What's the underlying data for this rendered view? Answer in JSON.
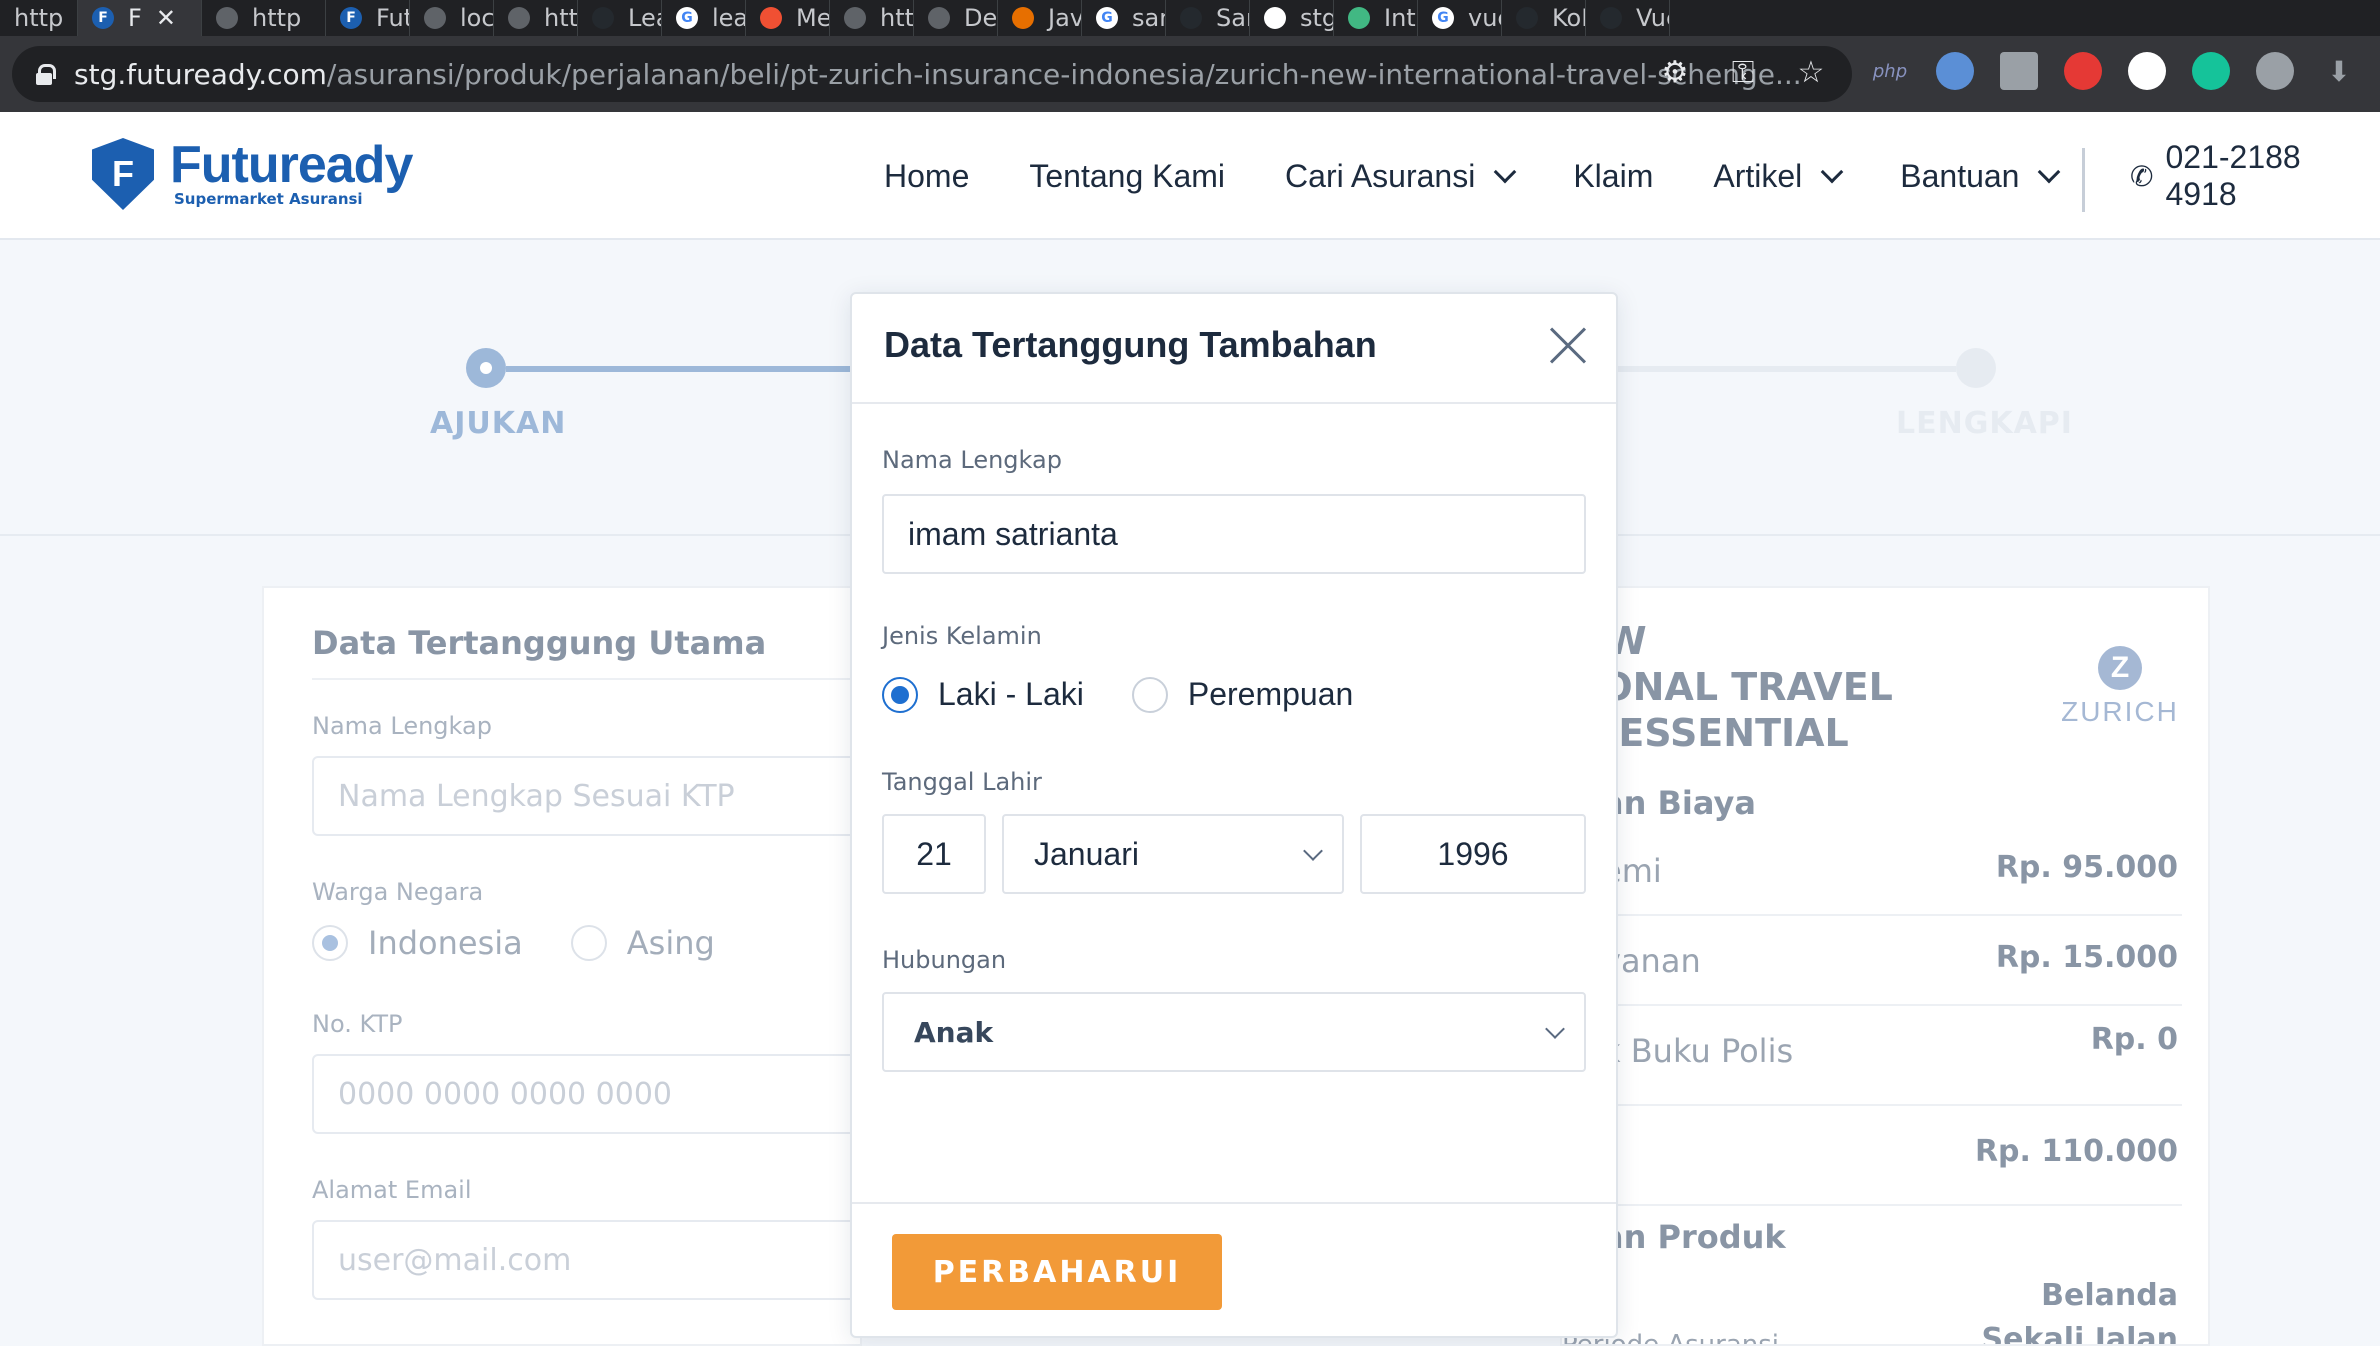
{
  "browser": {
    "tabs": [
      {
        "label": "http",
        "color": "#5f6368"
      },
      {
        "label": "F",
        "color": "#1c5fb0",
        "active": true
      },
      {
        "label": "http",
        "color": "#5f6368"
      },
      {
        "label": "Futu",
        "color": "#1c5fb0"
      },
      {
        "label": "loca",
        "color": "#5f6368"
      },
      {
        "label": "http",
        "color": "#5f6368"
      },
      {
        "label": "Lear",
        "color": "#24292e"
      },
      {
        "label": "learn",
        "color": "#4285f4"
      },
      {
        "label": "Men",
        "color": "#f05033"
      },
      {
        "label": "http",
        "color": "#5f6368"
      },
      {
        "label": "Dem",
        "color": "#5f6368"
      },
      {
        "label": "Java",
        "color": "#e76f00"
      },
      {
        "label": "sam",
        "color": "#4285f4"
      },
      {
        "label": "Sam",
        "color": "#24292e"
      },
      {
        "label": "stg.",
        "color": "#5f6368"
      },
      {
        "label": "Intro",
        "color": "#41b883"
      },
      {
        "label": "vue",
        "color": "#4285f4"
      },
      {
        "label": "KoR",
        "color": "#24292e"
      },
      {
        "label": "Vue",
        "color": "#24292e"
      }
    ],
    "url_host": "stg.futuready.com",
    "url_path": "/asuransi/produk/perjalanan/beli/pt-zurich-insurance-indonesia/zurich-new-international-travel-schenge...",
    "ext_label_php": "php"
  },
  "header": {
    "logo_letter": "F",
    "logo_name": "Futuready",
    "logo_tagline": "Supermarket Asuransi",
    "nav": {
      "home": "Home",
      "about": "Tentang Kami",
      "find": "Cari Asuransi",
      "claim": "Klaim",
      "article": "Artikel",
      "help": "Bantuan"
    },
    "phone": "021-2188 4918",
    "brand_color": "#1c5fb0"
  },
  "stepper": {
    "step1": "AJUKAN",
    "step3": "LENGKAPI"
  },
  "main_form": {
    "title": "Data Tertanggung Utama",
    "name_label": "Nama Lengkap",
    "name_placeholder": "Nama Lengkap Sesuai KTP",
    "nationality_label": "Warga Negara",
    "nationality_options": [
      "Indonesia",
      "Asing"
    ],
    "ktp_label": "No. KTP",
    "ktp_placeholder": "0000 0000 0000 0000",
    "email_label": "Alamat Email",
    "email_placeholder": "user@mail.com"
  },
  "summary": {
    "product_lines": [
      "H NEW",
      "NATIONAL TRAVEL",
      "IGEN ESSENTIAL"
    ],
    "insurer": "ZURICH",
    "cost_section": "an Biaya",
    "premium_label": "emi",
    "premium_value": "Rp. 95.000",
    "service_label": "yanan",
    "service_value": "Rp. 15.000",
    "book_label": "k Buku Polis",
    "book_value": "Rp. 0",
    "total_value": "Rp. 110.000",
    "product_section": "an Produk",
    "destination_value": "Belanda",
    "period_label": "Periode Asuransi",
    "period_value": "Sekali Jalan"
  },
  "modal": {
    "title": "Data Tertanggung Tambahan",
    "name_label": "Nama Lengkap",
    "name_value": "imam satrianta",
    "gender_label": "Jenis Kelamin",
    "gender_male": "Laki - Laki",
    "gender_female": "Perempuan",
    "gender_selected": "Laki - Laki",
    "dob_label": "Tanggal Lahir",
    "dob_day": "21",
    "dob_month": "Januari",
    "dob_year": "1996",
    "relation_label": "Hubungan",
    "relation_value": "Anak",
    "submit": "PERBAHARUI",
    "accent_color": "#f29a38",
    "radio_color": "#1e6fd0"
  }
}
